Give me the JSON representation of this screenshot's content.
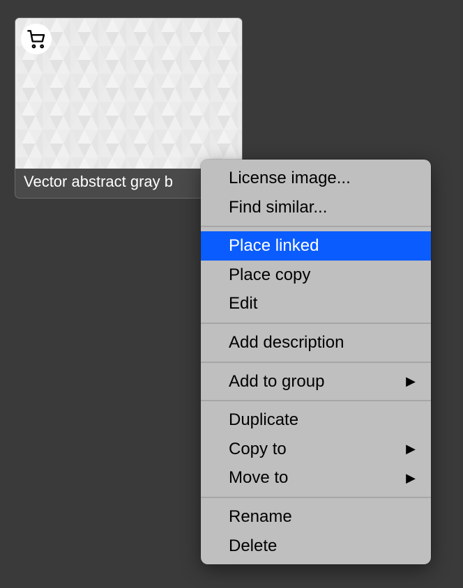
{
  "thumbnail": {
    "title": "Vector abstract gray b",
    "iconName": "shopping-cart-icon"
  },
  "contextMenu": {
    "groups": [
      [
        {
          "label": "License image...",
          "hasSubmenu": false,
          "highlighted": false,
          "name": "menu-license-image"
        },
        {
          "label": "Find similar...",
          "hasSubmenu": false,
          "highlighted": false,
          "name": "menu-find-similar"
        }
      ],
      [
        {
          "label": "Place linked",
          "hasSubmenu": false,
          "highlighted": true,
          "name": "menu-place-linked"
        },
        {
          "label": "Place copy",
          "hasSubmenu": false,
          "highlighted": false,
          "name": "menu-place-copy"
        },
        {
          "label": "Edit",
          "hasSubmenu": false,
          "highlighted": false,
          "name": "menu-edit"
        }
      ],
      [
        {
          "label": "Add description",
          "hasSubmenu": false,
          "highlighted": false,
          "name": "menu-add-description"
        }
      ],
      [
        {
          "label": "Add to group",
          "hasSubmenu": true,
          "highlighted": false,
          "name": "menu-add-to-group"
        }
      ],
      [
        {
          "label": "Duplicate",
          "hasSubmenu": false,
          "highlighted": false,
          "name": "menu-duplicate"
        },
        {
          "label": "Copy to",
          "hasSubmenu": true,
          "highlighted": false,
          "name": "menu-copy-to"
        },
        {
          "label": "Move to",
          "hasSubmenu": true,
          "highlighted": false,
          "name": "menu-move-to"
        }
      ],
      [
        {
          "label": "Rename",
          "hasSubmenu": false,
          "highlighted": false,
          "name": "menu-rename"
        },
        {
          "label": "Delete",
          "hasSubmenu": false,
          "highlighted": false,
          "name": "menu-delete"
        }
      ]
    ]
  }
}
